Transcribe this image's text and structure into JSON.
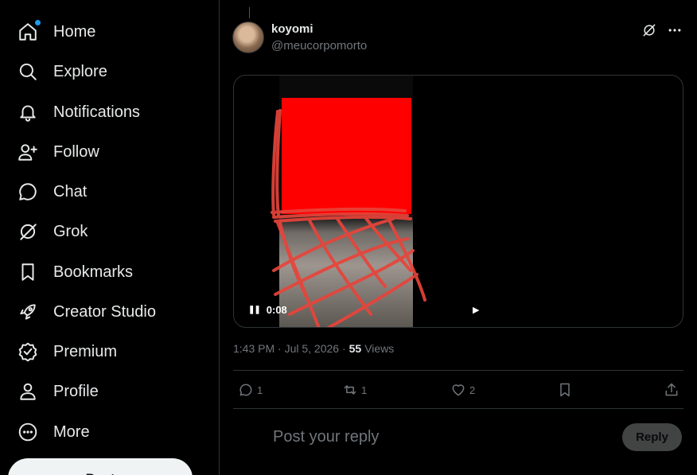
{
  "nav": {
    "items": [
      {
        "label": "Home",
        "icon": "home-icon"
      },
      {
        "label": "Explore",
        "icon": "search-icon"
      },
      {
        "label": "Notifications",
        "icon": "bell-icon"
      },
      {
        "label": "Follow",
        "icon": "follow-icon"
      },
      {
        "label": "Chat",
        "icon": "chat-icon"
      },
      {
        "label": "Grok",
        "icon": "grok-icon"
      },
      {
        "label": "Bookmarks",
        "icon": "bookmark-icon"
      },
      {
        "label": "Creator Studio",
        "icon": "rocket-icon"
      },
      {
        "label": "Premium",
        "icon": "premium-icon"
      },
      {
        "label": "Profile",
        "icon": "profile-icon"
      },
      {
        "label": "More",
        "icon": "more-icon"
      }
    ],
    "post_label": "Post"
  },
  "post": {
    "author_name": "koyomi",
    "author_handle": "@meucorpomorto",
    "video_time": "0:08",
    "timestamp": "1:43 PM · Jul 5, 2026 ·",
    "views_count": "55",
    "views_label": "Views",
    "replies": "1",
    "reposts": "1",
    "likes": "2"
  },
  "reply": {
    "placeholder": "Post your reply",
    "button_label": "Reply"
  },
  "colors": {
    "background": "#000000",
    "accent": "#1d9bf0",
    "muted": "#71767b",
    "redaction": "#ff0000",
    "scribble": "#e8443a"
  }
}
